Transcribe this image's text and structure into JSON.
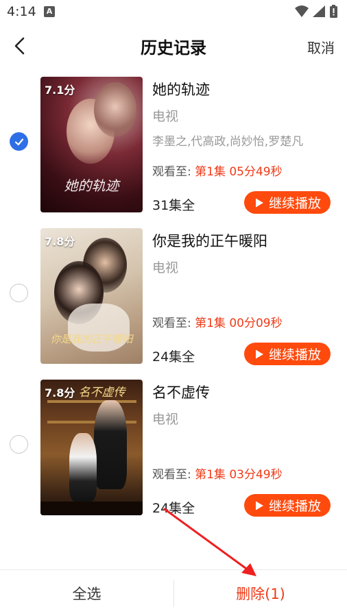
{
  "status_bar": {
    "time": "4:14",
    "notification_icon": "A"
  },
  "header": {
    "title": "历史记录",
    "cancel_label": "取消"
  },
  "items": [
    {
      "rating": "7.1分",
      "poster_title": "她的轨迹",
      "title": "她的轨迹",
      "type": "电视",
      "cast": "李墨之,代高政,尚妙怡,罗楚凡",
      "progress_label": "观看至:",
      "progress_value": "第1集 05分49秒",
      "episodes": "31集全",
      "play_label": "继续播放",
      "selected": true
    },
    {
      "rating": "7.8分",
      "poster_title": "你是我的正午暖阳",
      "title": "你是我的正午暖阳",
      "type": "电视",
      "cast": "",
      "progress_label": "观看至:",
      "progress_value": "第1集 00分09秒",
      "episodes": "24集全",
      "play_label": "继续播放",
      "selected": false
    },
    {
      "rating": "7.8分",
      "poster_title": "名不虚传",
      "title": "名不虚传",
      "type": "电视",
      "cast": "",
      "progress_label": "观看至:",
      "progress_value": "第1集 03分49秒",
      "episodes": "24集全",
      "play_label": "继续播放",
      "selected": false
    }
  ],
  "bottom_bar": {
    "select_all_label": "全选",
    "delete_label": "删除(1)"
  },
  "colors": {
    "accent": "#ff4a0d",
    "progress": "#ef3a17",
    "checked": "#2f6fe6"
  },
  "icons": [
    "back-arrow-icon",
    "check-icon",
    "play-triangle-icon",
    "wifi-icon",
    "signal-icon",
    "battery-icon"
  ]
}
